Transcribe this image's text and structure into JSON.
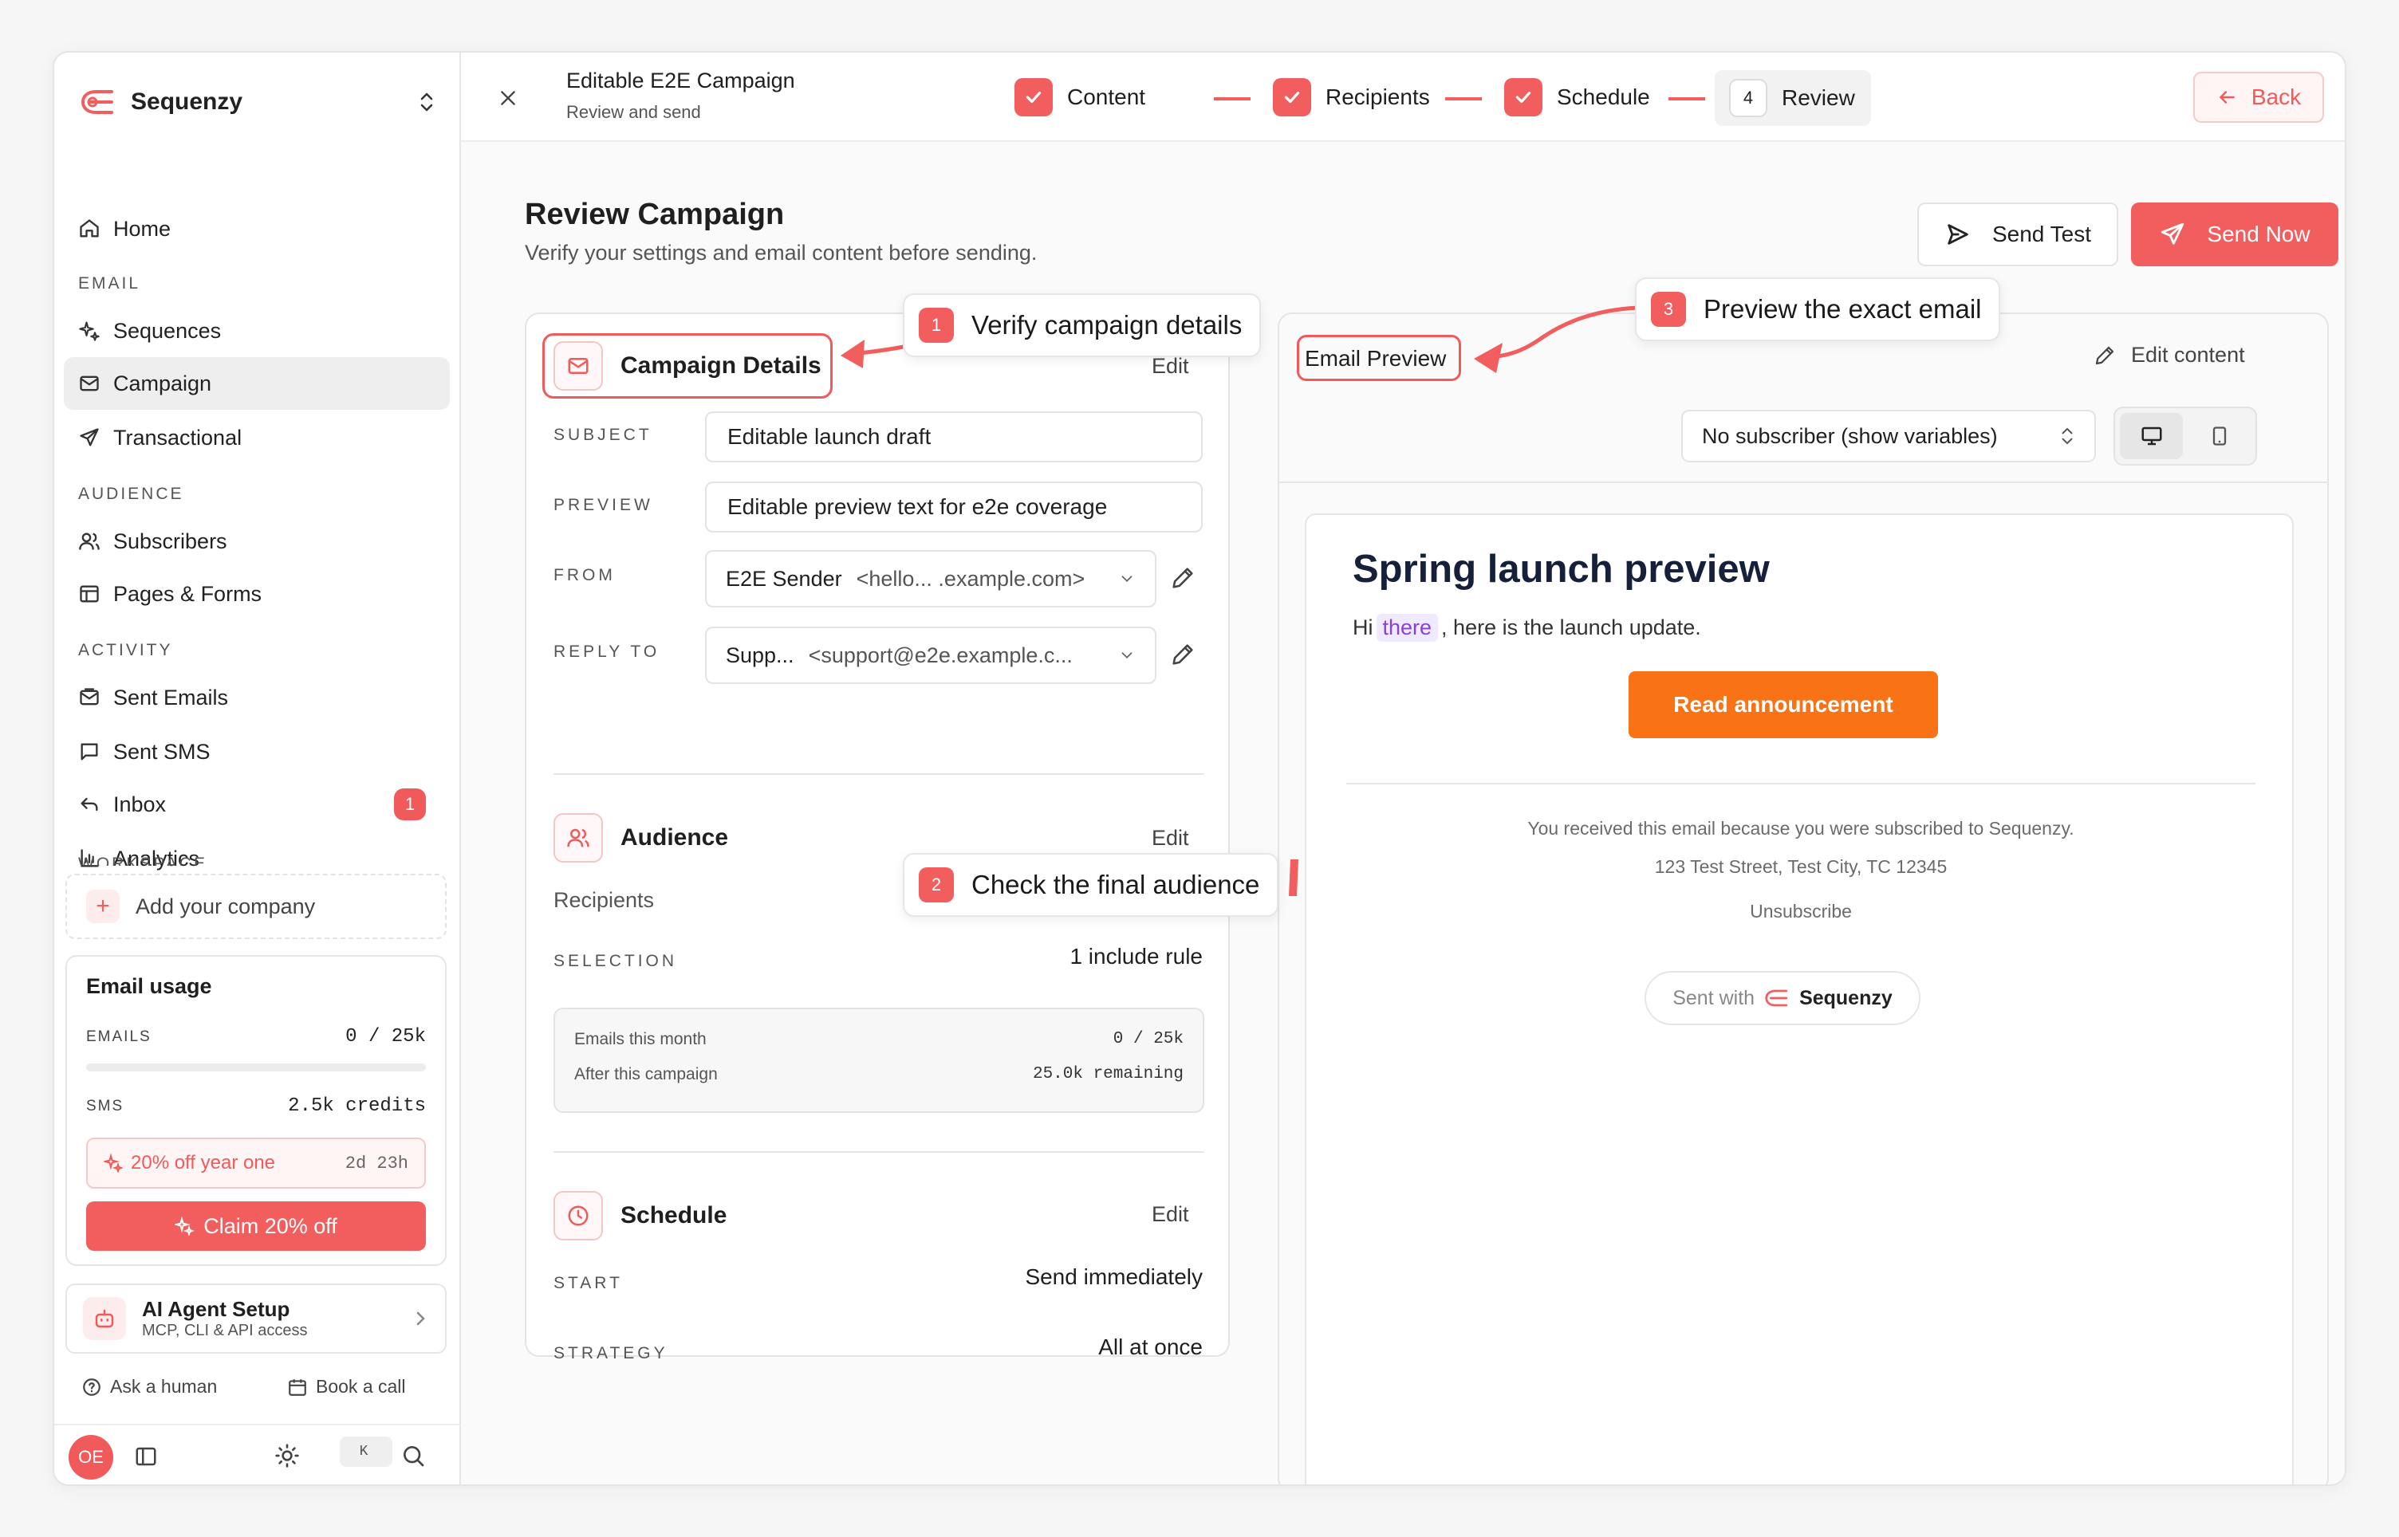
{
  "sidebar": {
    "brand": "Sequenzy",
    "nav": {
      "home": "Home",
      "section_email": "EMAIL",
      "sequences": "Sequences",
      "campaign": "Campaign",
      "transactional": "Transactional",
      "section_audience": "AUDIENCE",
      "subscribers": "Subscribers",
      "pages_forms": "Pages & Forms",
      "section_activity": "ACTIVITY",
      "sent_emails": "Sent Emails",
      "sent_sms": "Sent SMS",
      "inbox": "Inbox",
      "inbox_badge": "1",
      "analytics": "Analytics",
      "section_workspace": "WORKSPACE"
    },
    "add_company": "Add your company",
    "usage": {
      "title": "Email usage",
      "emails_label": "EMAILS",
      "emails_value": "0 / 25k",
      "emails_progress": 0,
      "sms_label": "SMS",
      "sms_value": "2.5k credits",
      "promo": "20% off year one",
      "promo_timer": "2d 23h",
      "claim": "Claim 20% off"
    },
    "agent": {
      "title": "AI Agent Setup",
      "subtitle": "MCP, CLI & API access"
    },
    "help": {
      "ask": "Ask a human",
      "book": "Book a call"
    },
    "avatar": "OE",
    "shortcut": "K"
  },
  "topbar": {
    "title": "Editable E2E Campaign",
    "subtitle": "Review and send",
    "steps": [
      "Content",
      "Recipients",
      "Schedule",
      "Review"
    ],
    "current_step_number": "4",
    "back": "Back"
  },
  "review": {
    "title": "Review Campaign",
    "subtitle": "Verify your settings and email content before sending.",
    "send_test": "Send Test",
    "send_now": "Send Now"
  },
  "details": {
    "title": "Campaign Details",
    "edit": "Edit",
    "subject_label": "SUBJECT",
    "subject": "Editable launch draft",
    "preview_label": "PREVIEW",
    "preview": "Editable preview text for e2e coverage",
    "from_label": "FROM",
    "from_name": "E2E Sender",
    "from_email": "<hello... .example.com>",
    "reply_label": "REPLY TO",
    "reply_name": "Supp...",
    "reply_email": "<support@e2e.example.c..."
  },
  "audience": {
    "title": "Audience",
    "edit": "Edit",
    "recipients": "Recipients",
    "selection_label": "SELECTION",
    "selection": "1 include rule",
    "emails_month_label": "Emails this month",
    "emails_month_value": "0 / 25k",
    "after_label": "After this campaign",
    "after_value": "25.0k remaining"
  },
  "schedule": {
    "title": "Schedule",
    "edit": "Edit",
    "start_label": "START",
    "start": "Send immediately",
    "strategy_label": "STRATEGY",
    "strategy": "All at once"
  },
  "callouts": {
    "c1_num": "1",
    "c1": "Verify campaign details",
    "c2_num": "2",
    "c2": "Check the final audience",
    "c3_num": "3",
    "c3": "Preview the exact email"
  },
  "preview": {
    "title": "Email Preview",
    "edit_content": "Edit content",
    "subscriber_select": "No subscriber (show variables)",
    "email": {
      "heading": "Spring launch preview",
      "hi": "Hi",
      "variable": "there",
      "body_rest": ", here is the launch update.",
      "button": "Read announcement",
      "footer1": "You received this email because you were subscribed to Sequenzy.",
      "footer2": "123 Test Street, Test City, TC 12345",
      "unsubscribe": "Unsubscribe",
      "sent_with": "Sent with",
      "brand": "Sequenzy"
    }
  },
  "colors": {
    "accent": "#f25e5e",
    "email_button": "#f97316",
    "variable": "#8b3fd8"
  }
}
